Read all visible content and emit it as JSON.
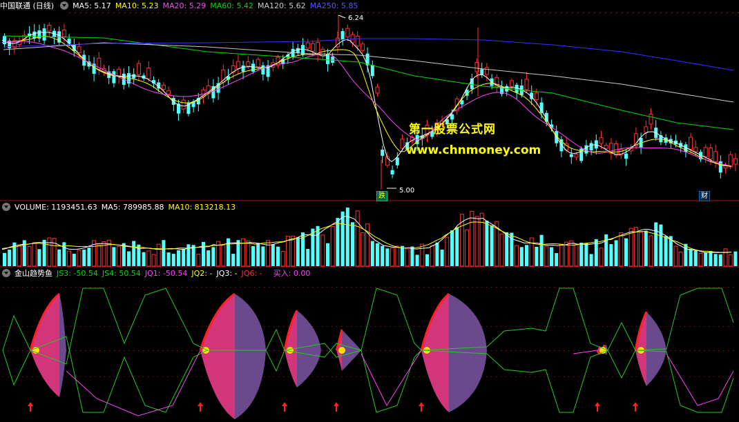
{
  "main_header": {
    "stock": "中国联通 (日线)",
    "ma5": "MA5: 5.17",
    "ma10": "MA10: 5.23",
    "ma20": "MA20: 5.29",
    "ma60": "MA60: 5.42",
    "ma120": "MA120: 5.62",
    "ma250": "MA250: 5.85"
  },
  "high_label": "6.24",
  "low_label": "5.00",
  "tag_die": "跌",
  "tag_cai": "财",
  "watermark_1": "第一股票公式网",
  "watermark_2": "www.chnmoney.com",
  "volume_header": {
    "volume": "VOLUME: 1193451.63",
    "ma5": "MA5: 789985.88",
    "ma10": "MA10: 813218.13"
  },
  "indicator_header": {
    "name": "金山趋势鱼",
    "js3": "JS3: -50.54",
    "js4": "JS4: 50.54",
    "jq1": "JQ1: -50.54",
    "jq2": "JQ2: -",
    "jq3": "JQ3: -",
    "jq6": "JQ6: -",
    "buy": "买入: 0.00"
  },
  "colors": {
    "up": "#ff3232",
    "down": "#54ffff",
    "ma5": "#ffffff",
    "ma10": "#ffff00",
    "ma20": "#ff44ff",
    "ma60": "#00dd00",
    "ma120": "#cccccc",
    "ma250": "#3333ff",
    "fish_pink": "#d2357a",
    "fish_purple": "#6a4a8c"
  },
  "chart_data": [
    {
      "type": "candlestick",
      "title": "中国联通 (日线)",
      "series": [
        {
          "name": "MA5",
          "last": 5.17
        },
        {
          "name": "MA10",
          "last": 5.23
        },
        {
          "name": "MA20",
          "last": 5.29
        },
        {
          "name": "MA60",
          "last": 5.42
        },
        {
          "name": "MA120",
          "last": 5.62
        },
        {
          "name": "MA250",
          "last": 5.85
        }
      ],
      "annotations": [
        "6.24",
        "5.00",
        "跌",
        "财"
      ],
      "ylim": [
        4.9,
        6.3
      ]
    },
    {
      "type": "bar",
      "title": "VOLUME",
      "series": [
        {
          "name": "VOLUME",
          "last": 1193451.63
        },
        {
          "name": "MA5",
          "last": 789985.88
        },
        {
          "name": "MA10",
          "last": 813218.13
        }
      ]
    },
    {
      "type": "area",
      "title": "金山趋势鱼",
      "series": [
        {
          "name": "JS3",
          "last": -50.54
        },
        {
          "name": "JS4",
          "last": 50.54
        },
        {
          "name": "JQ1",
          "last": -50.54
        }
      ],
      "ylim": [
        -100,
        100
      ]
    }
  ]
}
